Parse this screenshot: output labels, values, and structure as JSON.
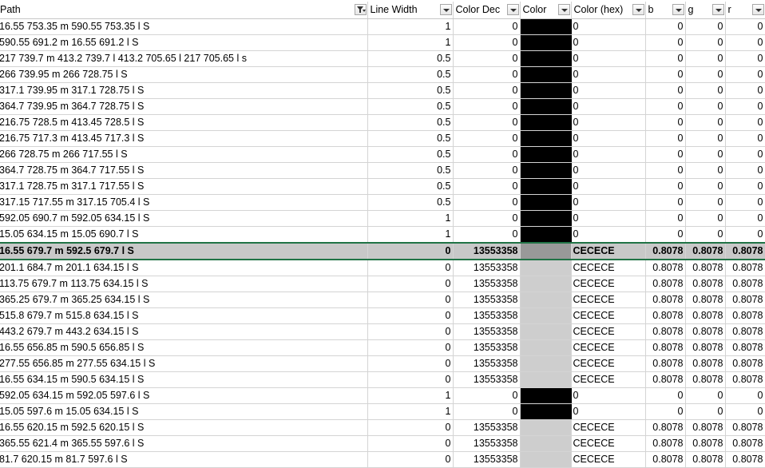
{
  "columns": [
    {
      "label": "Path",
      "filter": "active"
    },
    {
      "label": "Line Width",
      "filter": "dropdown"
    },
    {
      "label": "Color Dec",
      "filter": "dropdown"
    },
    {
      "label": "Color",
      "filter": "dropdown"
    },
    {
      "label": "Color (hex)",
      "filter": "dropdown"
    },
    {
      "label": "b",
      "filter": "dropdown"
    },
    {
      "label": "g",
      "filter": "dropdown"
    },
    {
      "label": "r",
      "filter": "dropdown"
    }
  ],
  "colors": {
    "black": "#000000",
    "gray": "#cecece",
    "selected_swatch": "#999999",
    "selection_border": "#217346"
  },
  "selected_row": 14,
  "rows": [
    {
      "path": "16.55 753.35 m 590.55 753.35 l S",
      "lw": "1",
      "dec": "0",
      "swatch": "#000000",
      "hex": "0",
      "b": "0",
      "g": "0",
      "r": "0"
    },
    {
      "path": "590.55 691.2 m 16.55 691.2 l S",
      "lw": "1",
      "dec": "0",
      "swatch": "#000000",
      "hex": "0",
      "b": "0",
      "g": "0",
      "r": "0"
    },
    {
      "path": "217 739.7 m 413.2 739.7 l 413.2 705.65 l 217 705.65 l s",
      "lw": "0.5",
      "dec": "0",
      "swatch": "#000000",
      "hex": "0",
      "b": "0",
      "g": "0",
      "r": "0"
    },
    {
      "path": "266 739.95 m 266 728.75 l S",
      "lw": "0.5",
      "dec": "0",
      "swatch": "#000000",
      "hex": "0",
      "b": "0",
      "g": "0",
      "r": "0"
    },
    {
      "path": "317.1 739.95 m 317.1 728.75 l S",
      "lw": "0.5",
      "dec": "0",
      "swatch": "#000000",
      "hex": "0",
      "b": "0",
      "g": "0",
      "r": "0"
    },
    {
      "path": "364.7 739.95 m 364.7 728.75 l S",
      "lw": "0.5",
      "dec": "0",
      "swatch": "#000000",
      "hex": "0",
      "b": "0",
      "g": "0",
      "r": "0"
    },
    {
      "path": "216.75 728.5 m 413.45 728.5 l S",
      "lw": "0.5",
      "dec": "0",
      "swatch": "#000000",
      "hex": "0",
      "b": "0",
      "g": "0",
      "r": "0"
    },
    {
      "path": "216.75 717.3 m 413.45 717.3 l S",
      "lw": "0.5",
      "dec": "0",
      "swatch": "#000000",
      "hex": "0",
      "b": "0",
      "g": "0",
      "r": "0"
    },
    {
      "path": "266 728.75 m 266 717.55 l S",
      "lw": "0.5",
      "dec": "0",
      "swatch": "#000000",
      "hex": "0",
      "b": "0",
      "g": "0",
      "r": "0"
    },
    {
      "path": "364.7 728.75 m 364.7 717.55 l S",
      "lw": "0.5",
      "dec": "0",
      "swatch": "#000000",
      "hex": "0",
      "b": "0",
      "g": "0",
      "r": "0"
    },
    {
      "path": "317.1 728.75 m 317.1 717.55 l S",
      "lw": "0.5",
      "dec": "0",
      "swatch": "#000000",
      "hex": "0",
      "b": "0",
      "g": "0",
      "r": "0"
    },
    {
      "path": "317.15 717.55 m 317.15 705.4 l S",
      "lw": "0.5",
      "dec": "0",
      "swatch": "#000000",
      "hex": "0",
      "b": "0",
      "g": "0",
      "r": "0"
    },
    {
      "path": "592.05 690.7 m 592.05 634.15 l S",
      "lw": "1",
      "dec": "0",
      "swatch": "#000000",
      "hex": "0",
      "b": "0",
      "g": "0",
      "r": "0"
    },
    {
      "path": "15.05 634.15 m 15.05 690.7 l S",
      "lw": "1",
      "dec": "0",
      "swatch": "#000000",
      "hex": "0",
      "b": "0",
      "g": "0",
      "r": "0"
    },
    {
      "path": "16.55 679.7 m 592.5 679.7 l S",
      "lw": "0",
      "dec": "13553358",
      "swatch": "#999999",
      "hex": "CECECE",
      "b": "0.8078",
      "g": "0.8078",
      "r": "0.8078"
    },
    {
      "path": "201.1 684.7 m 201.1 634.15 l S",
      "lw": "0",
      "dec": "13553358",
      "swatch": "#cecece",
      "hex": "CECECE",
      "b": "0.8078",
      "g": "0.8078",
      "r": "0.8078"
    },
    {
      "path": "113.75 679.7 m 113.75 634.15 l S",
      "lw": "0",
      "dec": "13553358",
      "swatch": "#cecece",
      "hex": "CECECE",
      "b": "0.8078",
      "g": "0.8078",
      "r": "0.8078"
    },
    {
      "path": "365.25 679.7 m 365.25 634.15 l S",
      "lw": "0",
      "dec": "13553358",
      "swatch": "#cecece",
      "hex": "CECECE",
      "b": "0.8078",
      "g": "0.8078",
      "r": "0.8078"
    },
    {
      "path": "515.8 679.7 m 515.8 634.15 l S",
      "lw": "0",
      "dec": "13553358",
      "swatch": "#cecece",
      "hex": "CECECE",
      "b": "0.8078",
      "g": "0.8078",
      "r": "0.8078"
    },
    {
      "path": "443.2 679.7 m 443.2 634.15 l S",
      "lw": "0",
      "dec": "13553358",
      "swatch": "#cecece",
      "hex": "CECECE",
      "b": "0.8078",
      "g": "0.8078",
      "r": "0.8078"
    },
    {
      "path": "16.55 656.85 m 590.5 656.85 l S",
      "lw": "0",
      "dec": "13553358",
      "swatch": "#cecece",
      "hex": "CECECE",
      "b": "0.8078",
      "g": "0.8078",
      "r": "0.8078"
    },
    {
      "path": "277.55 656.85 m 277.55 634.15 l S",
      "lw": "0",
      "dec": "13553358",
      "swatch": "#cecece",
      "hex": "CECECE",
      "b": "0.8078",
      "g": "0.8078",
      "r": "0.8078"
    },
    {
      "path": "16.55 634.15 m 590.5 634.15 l S",
      "lw": "0",
      "dec": "13553358",
      "swatch": "#cecece",
      "hex": "CECECE",
      "b": "0.8078",
      "g": "0.8078",
      "r": "0.8078"
    },
    {
      "path": "592.05 634.15 m 592.05 597.6 l S",
      "lw": "1",
      "dec": "0",
      "swatch": "#000000",
      "hex": "0",
      "b": "0",
      "g": "0",
      "r": "0"
    },
    {
      "path": "15.05 597.6 m 15.05 634.15 l S",
      "lw": "1",
      "dec": "0",
      "swatch": "#000000",
      "hex": "0",
      "b": "0",
      "g": "0",
      "r": "0"
    },
    {
      "path": "16.55 620.15 m 592.5 620.15 l S",
      "lw": "0",
      "dec": "13553358",
      "swatch": "#cecece",
      "hex": "CECECE",
      "b": "0.8078",
      "g": "0.8078",
      "r": "0.8078"
    },
    {
      "path": "365.55 621.4 m 365.55 597.6 l S",
      "lw": "0",
      "dec": "13553358",
      "swatch": "#cecece",
      "hex": "CECECE",
      "b": "0.8078",
      "g": "0.8078",
      "r": "0.8078"
    },
    {
      "path": "81.7 620.15 m 81.7 597.6 l S",
      "lw": "0",
      "dec": "13553358",
      "swatch": "#cecece",
      "hex": "CECECE",
      "b": "0.8078",
      "g": "0.8078",
      "r": "0.8078"
    }
  ]
}
